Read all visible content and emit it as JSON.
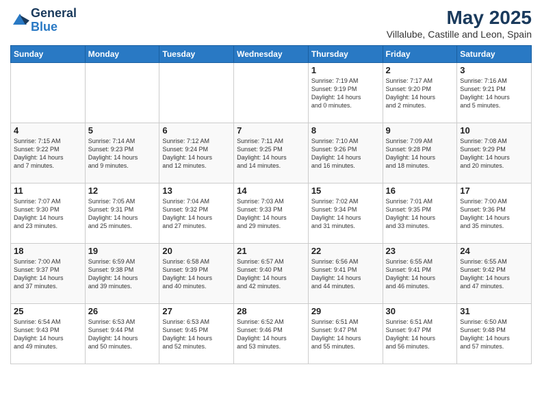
{
  "header": {
    "logo_line1": "General",
    "logo_line2": "Blue",
    "title": "May 2025",
    "subtitle": "Villalube, Castille and Leon, Spain"
  },
  "days_of_week": [
    "Sunday",
    "Monday",
    "Tuesday",
    "Wednesday",
    "Thursday",
    "Friday",
    "Saturday"
  ],
  "weeks": [
    [
      {
        "day": "",
        "info": ""
      },
      {
        "day": "",
        "info": ""
      },
      {
        "day": "",
        "info": ""
      },
      {
        "day": "",
        "info": ""
      },
      {
        "day": "1",
        "info": "Sunrise: 7:19 AM\nSunset: 9:19 PM\nDaylight: 14 hours\nand 0 minutes."
      },
      {
        "day": "2",
        "info": "Sunrise: 7:17 AM\nSunset: 9:20 PM\nDaylight: 14 hours\nand 2 minutes."
      },
      {
        "day": "3",
        "info": "Sunrise: 7:16 AM\nSunset: 9:21 PM\nDaylight: 14 hours\nand 5 minutes."
      }
    ],
    [
      {
        "day": "4",
        "info": "Sunrise: 7:15 AM\nSunset: 9:22 PM\nDaylight: 14 hours\nand 7 minutes."
      },
      {
        "day": "5",
        "info": "Sunrise: 7:14 AM\nSunset: 9:23 PM\nDaylight: 14 hours\nand 9 minutes."
      },
      {
        "day": "6",
        "info": "Sunrise: 7:12 AM\nSunset: 9:24 PM\nDaylight: 14 hours\nand 12 minutes."
      },
      {
        "day": "7",
        "info": "Sunrise: 7:11 AM\nSunset: 9:25 PM\nDaylight: 14 hours\nand 14 minutes."
      },
      {
        "day": "8",
        "info": "Sunrise: 7:10 AM\nSunset: 9:26 PM\nDaylight: 14 hours\nand 16 minutes."
      },
      {
        "day": "9",
        "info": "Sunrise: 7:09 AM\nSunset: 9:28 PM\nDaylight: 14 hours\nand 18 minutes."
      },
      {
        "day": "10",
        "info": "Sunrise: 7:08 AM\nSunset: 9:29 PM\nDaylight: 14 hours\nand 20 minutes."
      }
    ],
    [
      {
        "day": "11",
        "info": "Sunrise: 7:07 AM\nSunset: 9:30 PM\nDaylight: 14 hours\nand 23 minutes."
      },
      {
        "day": "12",
        "info": "Sunrise: 7:05 AM\nSunset: 9:31 PM\nDaylight: 14 hours\nand 25 minutes."
      },
      {
        "day": "13",
        "info": "Sunrise: 7:04 AM\nSunset: 9:32 PM\nDaylight: 14 hours\nand 27 minutes."
      },
      {
        "day": "14",
        "info": "Sunrise: 7:03 AM\nSunset: 9:33 PM\nDaylight: 14 hours\nand 29 minutes."
      },
      {
        "day": "15",
        "info": "Sunrise: 7:02 AM\nSunset: 9:34 PM\nDaylight: 14 hours\nand 31 minutes."
      },
      {
        "day": "16",
        "info": "Sunrise: 7:01 AM\nSunset: 9:35 PM\nDaylight: 14 hours\nand 33 minutes."
      },
      {
        "day": "17",
        "info": "Sunrise: 7:00 AM\nSunset: 9:36 PM\nDaylight: 14 hours\nand 35 minutes."
      }
    ],
    [
      {
        "day": "18",
        "info": "Sunrise: 7:00 AM\nSunset: 9:37 PM\nDaylight: 14 hours\nand 37 minutes."
      },
      {
        "day": "19",
        "info": "Sunrise: 6:59 AM\nSunset: 9:38 PM\nDaylight: 14 hours\nand 39 minutes."
      },
      {
        "day": "20",
        "info": "Sunrise: 6:58 AM\nSunset: 9:39 PM\nDaylight: 14 hours\nand 40 minutes."
      },
      {
        "day": "21",
        "info": "Sunrise: 6:57 AM\nSunset: 9:40 PM\nDaylight: 14 hours\nand 42 minutes."
      },
      {
        "day": "22",
        "info": "Sunrise: 6:56 AM\nSunset: 9:41 PM\nDaylight: 14 hours\nand 44 minutes."
      },
      {
        "day": "23",
        "info": "Sunrise: 6:55 AM\nSunset: 9:41 PM\nDaylight: 14 hours\nand 46 minutes."
      },
      {
        "day": "24",
        "info": "Sunrise: 6:55 AM\nSunset: 9:42 PM\nDaylight: 14 hours\nand 47 minutes."
      }
    ],
    [
      {
        "day": "25",
        "info": "Sunrise: 6:54 AM\nSunset: 9:43 PM\nDaylight: 14 hours\nand 49 minutes."
      },
      {
        "day": "26",
        "info": "Sunrise: 6:53 AM\nSunset: 9:44 PM\nDaylight: 14 hours\nand 50 minutes."
      },
      {
        "day": "27",
        "info": "Sunrise: 6:53 AM\nSunset: 9:45 PM\nDaylight: 14 hours\nand 52 minutes."
      },
      {
        "day": "28",
        "info": "Sunrise: 6:52 AM\nSunset: 9:46 PM\nDaylight: 14 hours\nand 53 minutes."
      },
      {
        "day": "29",
        "info": "Sunrise: 6:51 AM\nSunset: 9:47 PM\nDaylight: 14 hours\nand 55 minutes."
      },
      {
        "day": "30",
        "info": "Sunrise: 6:51 AM\nSunset: 9:47 PM\nDaylight: 14 hours\nand 56 minutes."
      },
      {
        "day": "31",
        "info": "Sunrise: 6:50 AM\nSunset: 9:48 PM\nDaylight: 14 hours\nand 57 minutes."
      }
    ]
  ]
}
